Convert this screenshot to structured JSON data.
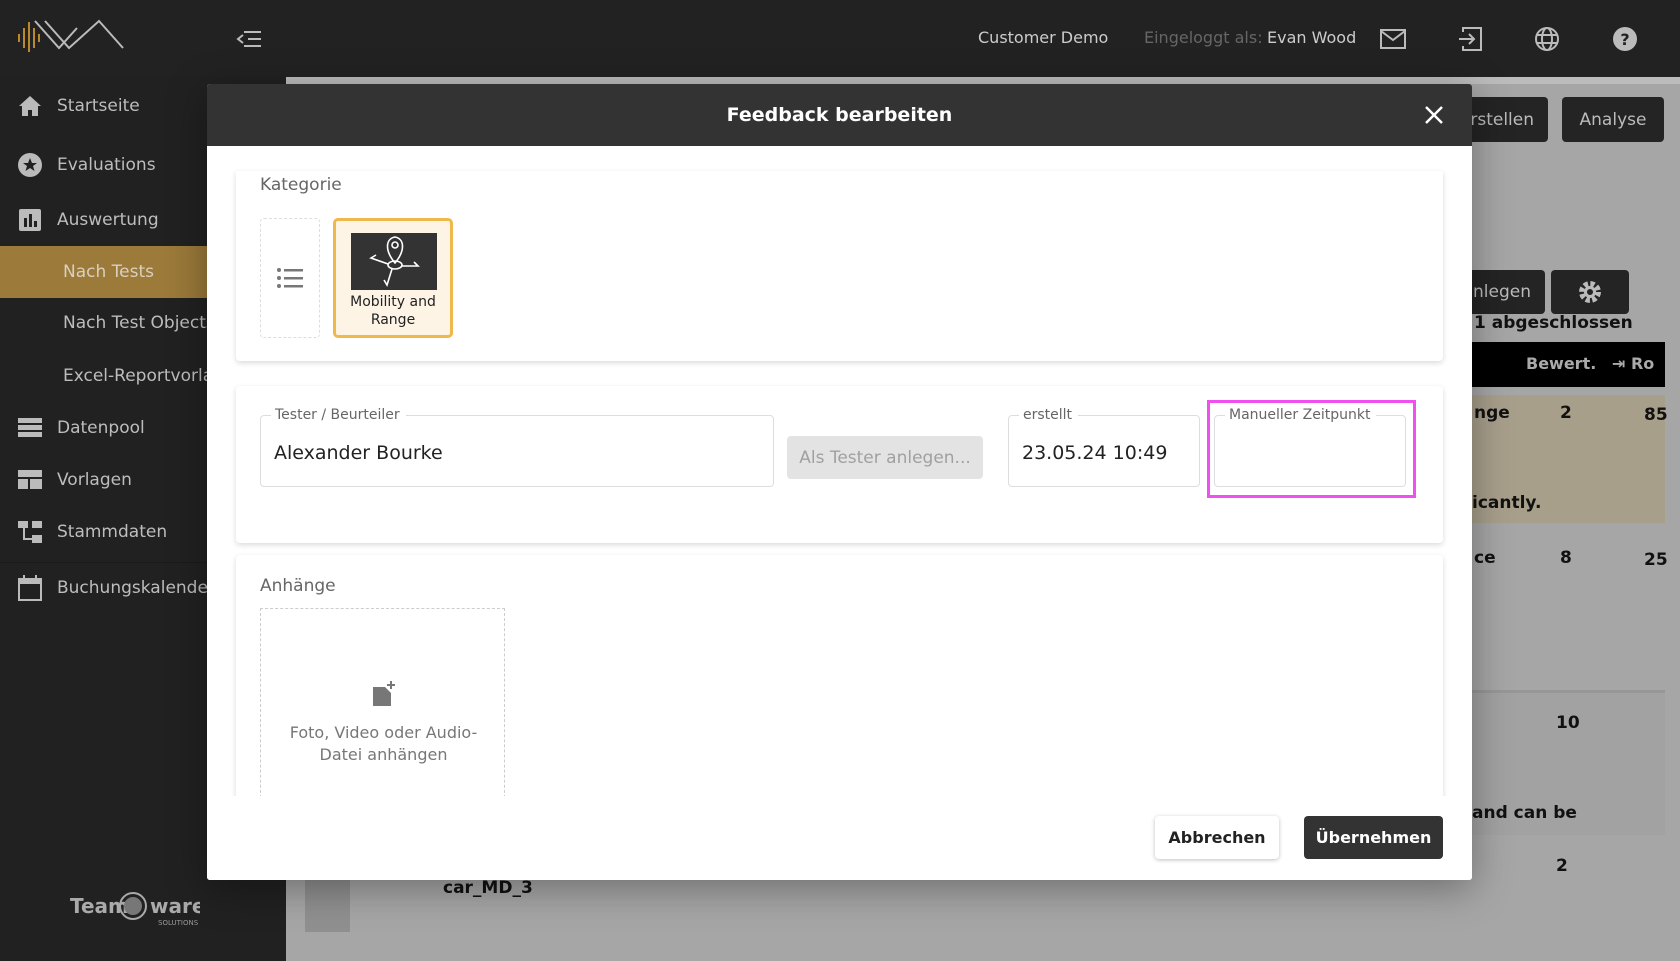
{
  "topbar": {
    "company": "Customer Demo",
    "logged_in_label": "Eingeloggt als:",
    "user": "Evan Wood",
    "icons": [
      "mail-icon",
      "logout-icon",
      "globe-icon",
      "help-icon"
    ]
  },
  "sidebar": {
    "items": [
      {
        "label": "Startseite",
        "icon": "home-icon"
      },
      {
        "label": "Evaluations",
        "icon": "star-icon"
      },
      {
        "label": "Auswertung",
        "icon": "bar-chart-icon"
      },
      {
        "label": "Nach Tests",
        "active": true
      },
      {
        "label": "Nach Test Objects"
      },
      {
        "label": "Excel-Reportvorlagen"
      },
      {
        "label": "Datenpool",
        "icon": "list-icon"
      },
      {
        "label": "Vorlagen",
        "icon": "template-icon"
      },
      {
        "label": "Stammdaten",
        "icon": "tree-icon"
      },
      {
        "label": "Buchungskalender",
        "icon": "calendar-icon"
      }
    ],
    "footer_logo": "Team ware SOLUTIONS"
  },
  "background": {
    "btn_create": "rstellen",
    "btn_analyse": "Analyse",
    "btn_add": "nlegen",
    "status": "1 abgeschlossen",
    "col_rating": "Bewert.",
    "col_ro": "Ro",
    "rows": [
      {
        "text": "nge",
        "rating": "2",
        "value": "85",
        "note": "icantly."
      },
      {
        "text": "ce",
        "rating": "8",
        "value": "25"
      },
      {
        "text": "",
        "rating": "10",
        "note": "and can be"
      },
      {
        "text": "car_MD_3",
        "rating": "2"
      }
    ]
  },
  "modal": {
    "title": "Feedback bearbeiten",
    "category": {
      "title": "Kategorie",
      "selected": "Mobility and Range"
    },
    "tester": {
      "label": "Tester / Beurteiler",
      "value": "Alexander Bourke",
      "create_button": "Als Tester anlegen..."
    },
    "created": {
      "label": "erstellt",
      "value": "23.05.24 10:49"
    },
    "manual_time": {
      "label": "Manueller Zeitpunkt",
      "value": ""
    },
    "attachments": {
      "title": "Anhänge",
      "dropzone": "Foto, Video oder Audio-Datei anhängen"
    },
    "cancel": "Abbrechen",
    "apply": "Übernehmen"
  },
  "colors": {
    "accent": "#f0b84a",
    "highlight": "#f050f0",
    "active_nav": "#9b7a3a"
  }
}
